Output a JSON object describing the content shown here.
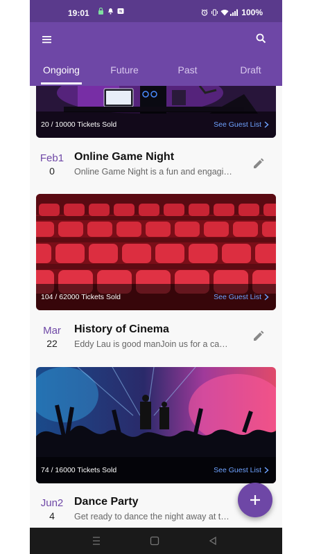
{
  "status_bar": {
    "time": "19:01",
    "battery": "100%",
    "left_icons": [
      "secure-icon",
      "notification-bell-icon",
      "nfc-icon"
    ],
    "right_icons": [
      "alarm-icon",
      "vibrate-icon",
      "wifi-icon",
      "signal-icon"
    ]
  },
  "app_bar": {
    "menu_icon": "menu-icon",
    "search_icon": "search-icon",
    "tabs": [
      {
        "label": "Ongoing",
        "active": true
      },
      {
        "label": "Future",
        "active": false
      },
      {
        "label": "Past",
        "active": false
      },
      {
        "label": "Draft",
        "active": false
      }
    ]
  },
  "events": [
    {
      "image": "gaming-setup-image",
      "tickets_sold": "20 / 10000 Tickets Sold",
      "guest_link": "See Guest List",
      "date_month": "Feb1",
      "date_day": "0",
      "title": "Online Game Night",
      "description": "Online Game Night is a fun and engagin..."
    },
    {
      "image": "cinema-seats-image",
      "tickets_sold": "104 / 62000 Tickets Sold",
      "guest_link": "See Guest List",
      "date_month": "Mar",
      "date_day": "22",
      "title": "History of Cinema",
      "description": "Eddy Lau is good manJoin us for a capt..."
    },
    {
      "image": "concert-crowd-image",
      "tickets_sold": "74 / 16000 Tickets Sold",
      "guest_link": "See Guest List",
      "date_month": "Jun2",
      "date_day": "4",
      "title": "Dance Party",
      "description": "Get ready to dance the night away at th..."
    }
  ],
  "fab_icon": "plus-icon",
  "colors": {
    "status_bar": "#5a3a8c",
    "app_bar": "#6e47a6",
    "accent": "#6e47a6",
    "link": "#6ea2ff",
    "nav_bar": "#1a1a1a"
  },
  "nav_bar": [
    "recents-icon",
    "home-icon",
    "back-icon"
  ]
}
